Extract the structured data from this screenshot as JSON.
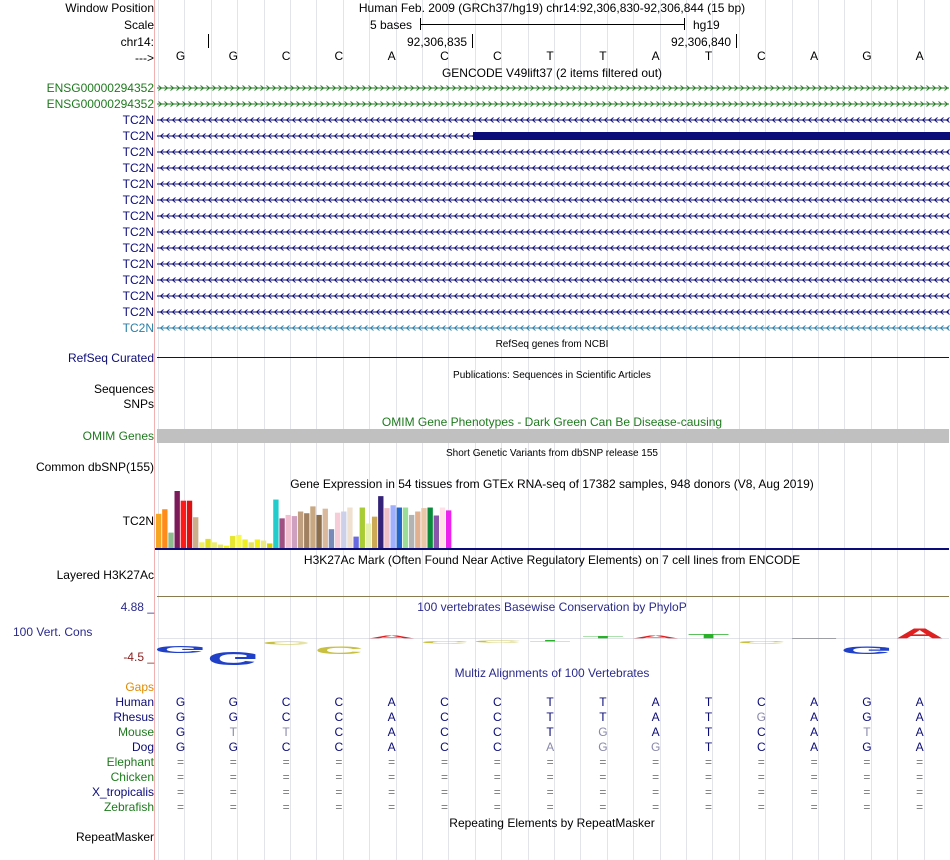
{
  "ruler": {
    "window_position_label": "Window Position",
    "scale_label": "Scale",
    "chrom_label": "chr14:",
    "arrow_label": "--->",
    "assembly_text": "Human Feb. 2009 (GRCh37/hg19)   chr14:92,306,830-92,306,844 (15 bp)",
    "scale_text": "5 bases",
    "db_text": "hg19",
    "tick_left": "92,306,835",
    "tick_right": "92,306,840"
  },
  "bases": [
    "G",
    "G",
    "C",
    "C",
    "A",
    "C",
    "C",
    "T",
    "T",
    "A",
    "T",
    "C",
    "A",
    "G",
    "A"
  ],
  "gencode": {
    "title": "GENCODE V49lift37 (2 items filtered out)",
    "rows": [
      {
        "label": "ENSG00000294352",
        "color": "#1e7a1e",
        "dir": ">"
      },
      {
        "label": "ENSG00000294352",
        "color": "#1e7a1e",
        "dir": ">"
      },
      {
        "label": "TC2N",
        "color": "#0c0c78",
        "dir": "<"
      },
      {
        "label": "TC2N",
        "color": "#0c0c78",
        "dir": "<",
        "thick_from": 473
      },
      {
        "label": "TC2N",
        "color": "#0c0c78",
        "dir": "<"
      },
      {
        "label": "TC2N",
        "color": "#0c0c78",
        "dir": "<"
      },
      {
        "label": "TC2N",
        "color": "#0c0c78",
        "dir": "<"
      },
      {
        "label": "TC2N",
        "color": "#0c0c78",
        "dir": "<"
      },
      {
        "label": "TC2N",
        "color": "#0c0c78",
        "dir": "<"
      },
      {
        "label": "TC2N",
        "color": "#0c0c78",
        "dir": "<"
      },
      {
        "label": "TC2N",
        "color": "#0c0c78",
        "dir": "<"
      },
      {
        "label": "TC2N",
        "color": "#0c0c78",
        "dir": "<"
      },
      {
        "label": "TC2N",
        "color": "#0c0c78",
        "dir": "<"
      },
      {
        "label": "TC2N",
        "color": "#0c0c78",
        "dir": "<"
      },
      {
        "label": "TC2N",
        "color": "#0c0c78",
        "dir": "<"
      },
      {
        "label": "TC2N",
        "color": "#2a7fa8",
        "dir": "<"
      }
    ]
  },
  "refseq": {
    "title": "RefSeq genes from NCBI",
    "label": "RefSeq Curated",
    "color": "#0c0c78"
  },
  "pubs": {
    "title": "Publications: Sequences in Scientific Articles",
    "label_seq": "Sequences",
    "label_snps": "SNPs"
  },
  "omim": {
    "title": "OMIM Gene Phenotypes - Dark Green Can Be Disease-causing",
    "label": "OMIM Genes",
    "color": "#1e7a1e",
    "bar_color": "#c0c0c0"
  },
  "dbsnp": {
    "title": "Short Genetic Variants from dbSNP release 155",
    "label": "Common dbSNP(155)"
  },
  "gtex": {
    "title": "Gene Expression in 54 tissues from GTEx RNA-seq of 17382 samples, 948 donors (V8, Aug 2019)",
    "label": "TC2N",
    "chart_data": {
      "type": "bar",
      "ylim": [
        0,
        1
      ],
      "values": [
        0.6,
        0.68,
        0.27,
        1.0,
        0.83,
        0.83,
        0.54,
        0.1,
        0.16,
        0.1,
        0.06,
        0.04,
        0.21,
        0.23,
        0.15,
        0.1,
        0.15,
        0.13,
        0.08,
        0.85,
        0.52,
        0.58,
        0.56,
        0.64,
        0.61,
        0.73,
        0.58,
        0.69,
        0.33,
        0.62,
        0.64,
        0.71,
        0.2,
        0.71,
        0.43,
        0.55,
        0.91,
        0.7,
        0.75,
        0.71,
        0.71,
        0.58,
        0.64,
        0.7,
        0.71,
        0.57,
        0.71,
        0.66
      ],
      "colors": [
        "#f5a623",
        "#ff8c1a",
        "#8fbc8f",
        "#7b1b5a",
        "#ff1a1a",
        "#dd1111",
        "#ccb08c",
        "#f0f060",
        "#e0e020",
        "#ecec70",
        "#e8e860",
        "#f5f500",
        "#e6e630",
        "#f8f850",
        "#eeee20",
        "#e4e460",
        "#f2f210",
        "#eaea80",
        "#d0d000",
        "#22cccc",
        "#a05082",
        "#f0c0d0",
        "#d0a0c0",
        "#bf9f80",
        "#a08060",
        "#c8a882",
        "#8b6e4b",
        "#d9b89c",
        "#7a8ab8",
        "#f5ccd8",
        "#ccd0e8",
        "#f0e0d0",
        "#6a6ae0",
        "#a8cc33",
        "#e6f0b0",
        "#ccaa55",
        "#332277",
        "#f0c0c8",
        "#a0b0ff",
        "#2266cc",
        "#99dd99",
        "#b3b3b3",
        "#e0b090",
        "#e8c8a8",
        "#0a8a3a",
        "#8855aa",
        "#ffe0e8",
        "#ee22ee"
      ]
    }
  },
  "h3k27": {
    "title": "H3K27Ac Mark (Often Found Near Active Regulatory Elements) on 7 cell lines from ENCODE",
    "label": "Layered H3K27Ac"
  },
  "phylop": {
    "title": "100 vertebrates Basewise Conservation by PhyloP",
    "label": "100 Vert. Cons",
    "ymax": "4.88 _",
    "ymin": "-4.5 _"
  },
  "multiz": {
    "title": "Multiz Alignments of 100 Vertebrates",
    "gaps_label": "Gaps",
    "species": [
      {
        "name": "Human",
        "color": "#0c0c78",
        "bases": [
          "G",
          "G",
          "C",
          "C",
          "A",
          "C",
          "C",
          "T",
          "T",
          "A",
          "T",
          "C",
          "A",
          "G",
          "A"
        ],
        "faded": []
      },
      {
        "name": "Rhesus",
        "color": "#0c0c78",
        "bases": [
          "G",
          "G",
          "C",
          "C",
          "A",
          "C",
          "C",
          "T",
          "T",
          "A",
          "T",
          "G",
          "A",
          "G",
          "A"
        ],
        "faded": [
          11
        ]
      },
      {
        "name": "Mouse",
        "color": "#1e7a1e",
        "bases": [
          "G",
          "T",
          "T",
          "C",
          "A",
          "C",
          "C",
          "T",
          "G",
          "A",
          "T",
          "C",
          "A",
          "T",
          "A"
        ],
        "faded": [
          1,
          2,
          8,
          13
        ]
      },
      {
        "name": "Dog",
        "color": "#0c0c78",
        "bases": [
          "G",
          "G",
          "C",
          "C",
          "A",
          "C",
          "C",
          "A",
          "G",
          "G",
          "T",
          "C",
          "A",
          "G",
          "A"
        ],
        "faded": [
          7,
          8,
          9
        ]
      },
      {
        "name": "Elephant",
        "color": "#1e7a1e",
        "bases": [
          "=",
          "=",
          "=",
          "=",
          "=",
          "=",
          "=",
          "=",
          "=",
          "=",
          "=",
          "=",
          "=",
          "=",
          "="
        ],
        "faded": []
      },
      {
        "name": "Chicken",
        "color": "#1e7a1e",
        "bases": [
          "=",
          "=",
          "=",
          "=",
          "=",
          "=",
          "=",
          "=",
          "=",
          "=",
          "=",
          "=",
          "=",
          "=",
          "="
        ],
        "faded": []
      },
      {
        "name": "X_tropicalis",
        "color": "#0c0c78",
        "bases": [
          "=",
          "=",
          "=",
          "=",
          "=",
          "=",
          "=",
          "=",
          "=",
          "=",
          "=",
          "=",
          "=",
          "=",
          "="
        ],
        "faded": []
      },
      {
        "name": "Zebrafish",
        "color": "#1e7a1e",
        "bases": [
          "=",
          "=",
          "=",
          "=",
          "=",
          "=",
          "=",
          "=",
          "=",
          "=",
          "=",
          "=",
          "=",
          "=",
          "="
        ],
        "faded": []
      }
    ]
  },
  "repeat": {
    "title": "Repeating Elements by RepeatMasker",
    "label": "RepeatMasker"
  },
  "colors": {
    "gencode_green": "#1e7a1e",
    "gene_blue": "#0c0c78",
    "faded_base": "#8888aa",
    "gaps_orange": "#e08a00",
    "phylop_pos": "#e02020",
    "phylop_neg": "#2040c8",
    "text_blue": "#2a2a8c",
    "label_red": "#8b2020"
  }
}
